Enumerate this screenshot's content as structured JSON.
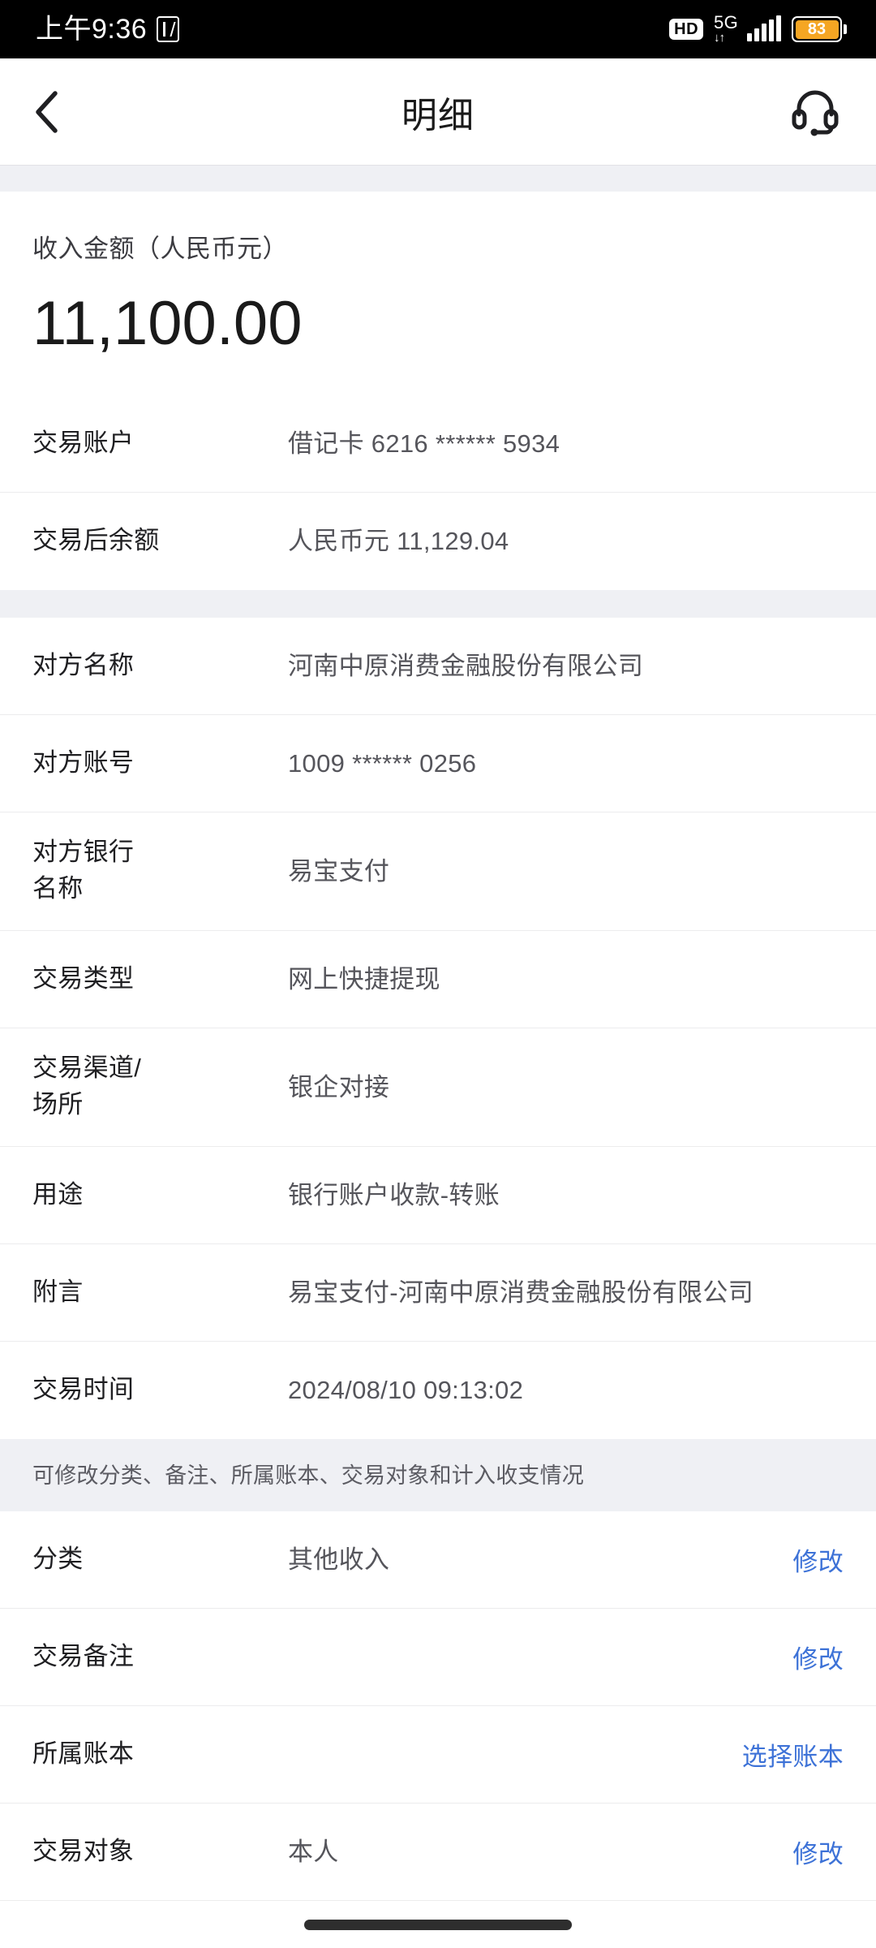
{
  "status_bar": {
    "time": "上午9:36",
    "nfc_icon": "nfc-icon",
    "hd_label": "HD",
    "network_label": "5G",
    "network_arrows": "↓↑",
    "battery_percent": "83",
    "battery_color": "#f5a623"
  },
  "header": {
    "back_icon": "chevron-left-icon",
    "title": "明细",
    "service_icon": "headset-icon"
  },
  "amount": {
    "label": "收入金额（人民币元）",
    "value": "11,100.00"
  },
  "account_section": {
    "rows": [
      {
        "label": "交易账户",
        "value": "借记卡 6216 ****** 5934"
      },
      {
        "label": "交易后余额",
        "value": "人民币元 11,129.04"
      }
    ]
  },
  "detail_section": {
    "rows": [
      {
        "label": "对方名称",
        "value": "河南中原消费金融股份有限公司"
      },
      {
        "label": "对方账号",
        "value": "1009 ****** 0256"
      },
      {
        "label": "对方银行\n名称",
        "value": "易宝支付"
      },
      {
        "label": "交易类型",
        "value": "网上快捷提现"
      },
      {
        "label": "交易渠道/\n场所",
        "value": "银企对接"
      },
      {
        "label": "用途",
        "value": "银行账户收款-转账"
      },
      {
        "label": "附言",
        "value": "易宝支付-河南中原消费金融股份有限公司"
      },
      {
        "label": "交易时间",
        "value": "2024/08/10 09:13:02"
      }
    ]
  },
  "notice": {
    "text": "可修改分类、备注、所属账本、交易对象和计入收支情况"
  },
  "editable_section": {
    "link_color": "#3d72d7",
    "rows": [
      {
        "label": "分类",
        "value": "其他收入",
        "action": "修改"
      },
      {
        "label": "交易备注",
        "value": "",
        "action": "修改"
      },
      {
        "label": "所属账本",
        "value": "",
        "action": "选择账本"
      },
      {
        "label": "交易对象",
        "value": "本人",
        "action": "修改"
      }
    ]
  },
  "home_indicator": {
    "name": "home-indicator"
  }
}
